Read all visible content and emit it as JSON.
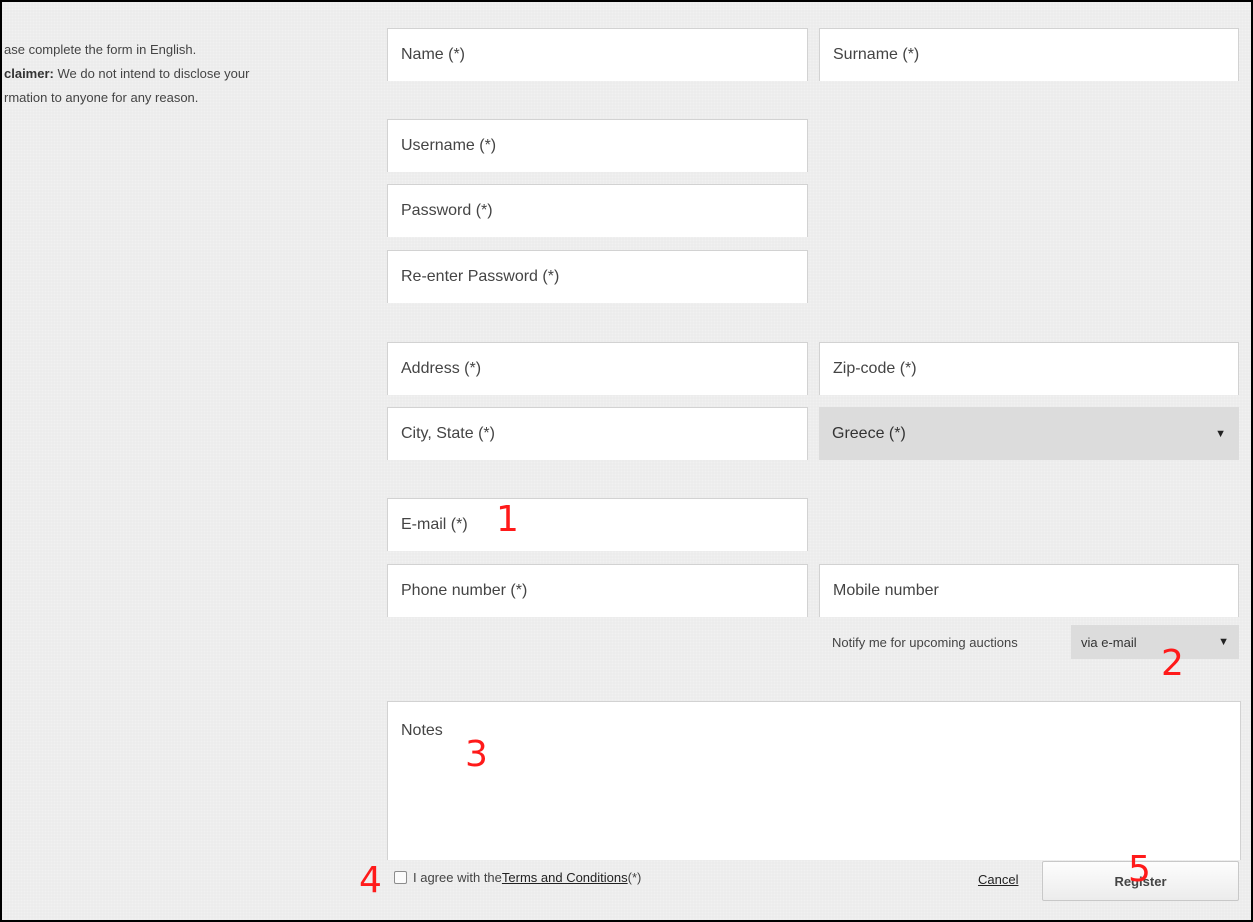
{
  "intro": {
    "line1": "ase complete the form in English.",
    "disclaimer_label": "claimer:",
    "line2_rest": " We do not intend to disclose your",
    "line3": "rmation to anyone for any reason."
  },
  "form": {
    "name": "Name (*)",
    "surname": "Surname (*)",
    "username": "Username (*)",
    "password": "Password (*)",
    "reenter_password": "Re-enter Password (*)",
    "address": "Address (*)",
    "zipcode": "Zip-code (*)",
    "city_state": "City, State (*)",
    "country": "Greece (*)",
    "email": "E-mail (*)",
    "phone": "Phone number (*)",
    "mobile": "Mobile number",
    "notify_label": "Notify me for upcoming auctions",
    "notify_value": "via e-mail",
    "notes": "Notes",
    "agree_prefix": "I agree with the ",
    "agree_link": "Terms and Conditions",
    "agree_suffix": " (*)",
    "cancel": "Cancel",
    "register": "Register"
  },
  "icons": {
    "dropdown_arrow": "▼"
  },
  "markers": [
    "1",
    "2",
    "3",
    "4",
    "5"
  ]
}
